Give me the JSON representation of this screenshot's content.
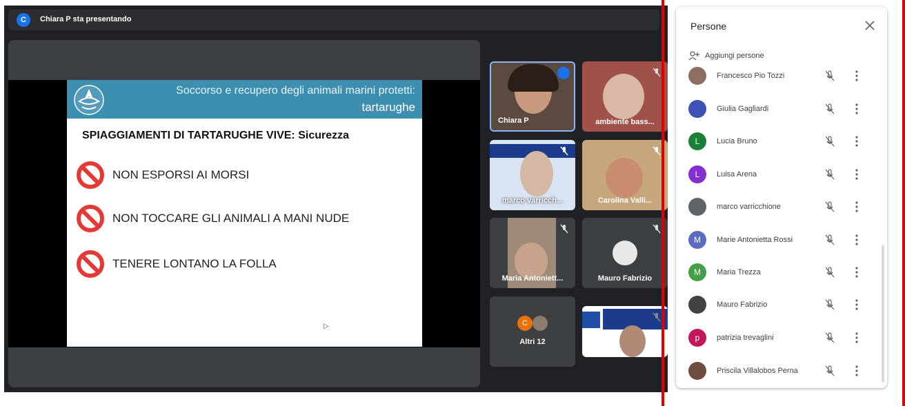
{
  "presenter": {
    "avatar_letter": "C",
    "label": "Chiara P sta presentando"
  },
  "slide": {
    "title_line1": "Soccorso e recupero degli animali marini protetti:",
    "title_line2": "tartarughe",
    "heading": "SPIAGGIAMENTI DI TARTARUGHE VIVE: Sicurezza",
    "bullets": [
      "NON ESPORSI AI MORSI",
      "NON TOCCARE GLI ANIMALI A MANI NUDE",
      "TENERE LONTANO LA FOLLA"
    ]
  },
  "tiles": {
    "t1": "Chiara P",
    "t2": "ambiente bass...",
    "t3": "marco varricch...",
    "t4": "Carolina Valli...",
    "t5": "Maria Antoniett...",
    "t6": "Mauro Fabrizio",
    "t7": "Altri 12",
    "t7_avatar": "C"
  },
  "panel": {
    "title": "Persone",
    "add_label": "Aggiungi persone",
    "people": [
      {
        "name": "Francesco Pio Tozzi",
        "initial": "",
        "color": "#8d6e63"
      },
      {
        "name": "Giulia Gagliardi",
        "initial": "",
        "color": "#3f51b5"
      },
      {
        "name": "Lucia Bruno",
        "initial": "L",
        "color": "#188038"
      },
      {
        "name": "Luisa Arena",
        "initial": "L",
        "color": "#8430ce"
      },
      {
        "name": "marco varricchione",
        "initial": "",
        "color": "#5f6368"
      },
      {
        "name": "Marie Antonietta Rossi",
        "initial": "M",
        "color": "#5c6bc0"
      },
      {
        "name": "Maria Trezza",
        "initial": "M",
        "color": "#43a047"
      },
      {
        "name": "Mauro Fabrizio",
        "initial": "",
        "color": "#424242"
      },
      {
        "name": "patrizia trevaglini",
        "initial": "p",
        "color": "#c2185b"
      },
      {
        "name": "Priscila Villalobos Perna",
        "initial": "",
        "color": "#6d4c41"
      }
    ]
  },
  "colors": {
    "accent": "#1a73e8",
    "alert_red": "#e00000",
    "slide_header": "#3d8fb0"
  }
}
